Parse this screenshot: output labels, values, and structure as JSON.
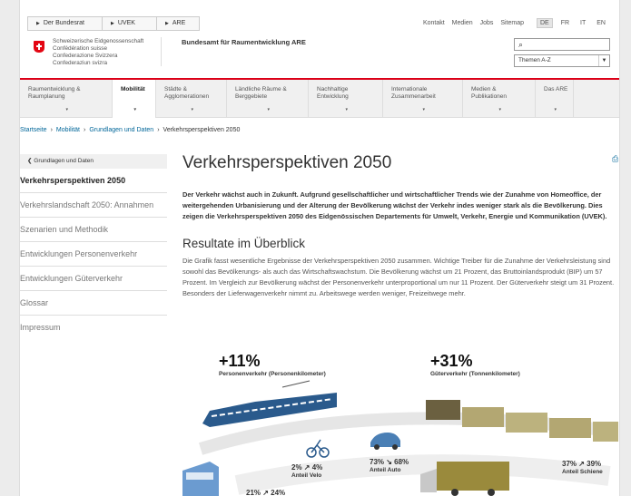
{
  "topbar": {
    "crumbs": [
      "Der Bundesrat",
      "UVEK",
      "ARE"
    ],
    "links": [
      "Kontakt",
      "Medien",
      "Jobs",
      "Sitemap"
    ],
    "languages": [
      "DE",
      "FR",
      "IT",
      "EN"
    ],
    "active_lang": "DE"
  },
  "header": {
    "confederation": [
      "Schweizerische Eidgenossenschaft",
      "Confédération suisse",
      "Confederazione Svizzera",
      "Confederaziun svizra"
    ],
    "office": "Bundesamt für Raumentwicklung ARE",
    "select_value": "Themen A-Z"
  },
  "nav": {
    "items": [
      [
        "Raumentwicklung &",
        "Raumplanung"
      ],
      [
        "Mobilität"
      ],
      [
        "Städte &",
        "Agglomerationen"
      ],
      [
        "Ländliche Räume &",
        "Berggebiete"
      ],
      [
        "Nachhaltige",
        "Entwicklung"
      ],
      [
        "Internationale",
        "Zusammenarbeit"
      ],
      [
        "Medien &",
        "Publikationen"
      ],
      [
        "Das ARE"
      ]
    ]
  },
  "breadcrumb": {
    "items": [
      "Startseite",
      "Mobilität",
      "Grundlagen und Daten"
    ],
    "current": "Verkehrsperspektiven 2050"
  },
  "sidebar": {
    "back": "Grundlagen und Daten",
    "items": [
      "Verkehrsperspektiven 2050",
      "Verkehrslandschaft 2050: Annahmen",
      "Szenarien und Methodik",
      "Entwicklungen Personenverkehr",
      "Entwicklungen Güterverkehr",
      "Glossar",
      "Impressum"
    ]
  },
  "main": {
    "title": "Verkehrsperspektiven 2050",
    "lead": "Der Verkehr wächst auch in Zukunft. Aufgrund gesellschaftlicher und wirtschaftlicher Trends wie der Zunahme von Homeoffice, der weitergehenden Urbanisierung und der Alterung der Bevölkerung wächst der Verkehr indes weniger stark als die Bevölkerung. Dies zeigen die Verkehrsperspektiven 2050 des Eidgenössischen Departements für Umwelt, Verkehr, Energie und Kommunikation (UVEK).",
    "subtitle": "Resultate im Überblick",
    "body": "Die Grafik fasst wesentliche Ergebnisse der Verkehrsperspektiven 2050 zusammen. Wichtige Treiber für die Zunahme der Verkehrsleistung sind sowohl das Bevölkerungs- als auch das Wirtschaftswachstum. Die Bevölkerung wächst um 21 Prozent, das Bruttoinlandsprodukt (BIP) um 57 Prozent. Im Vergleich zur Bevölkerung wächst der Personenverkehr unterproportional um nur 11 Prozent. Der Güterverkehr steigt um 31 Prozent. Besonders der Lieferwagenverkehr nimmt zu. Arbeitswege werden weniger, Freizeitwege mehr."
  },
  "graphic": {
    "person_pct": "+11%",
    "person_label": "Personenverkehr (Personenkilometer)",
    "goods_pct": "+31%",
    "goods_label": "Güterverkehr (Tonnenkilometer)",
    "velo_pct": "2% ↗ 4%",
    "velo_label": "Anteil Velo",
    "auto_pct": "73% ↘ 68%",
    "auto_label": "Anteil Auto",
    "schiene_pct": "37% ↗ 39%",
    "schiene_label": "Anteil Schiene",
    "oev_pct": "21% ↗ 24%"
  },
  "colors": {
    "accent": "#dc0018",
    "link": "#006699",
    "train_blue": "#2a5a8c",
    "freight": "#8a7a3c"
  }
}
